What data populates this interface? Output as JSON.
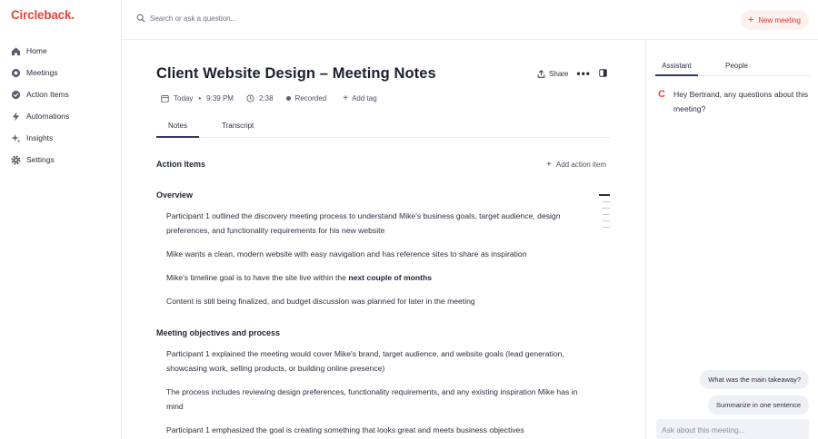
{
  "brand": {
    "logo_text": "Circleback",
    "logo_dot": ".",
    "accent": "#e8443a"
  },
  "sidebar": {
    "items": [
      {
        "label": "Home",
        "icon": "home-icon"
      },
      {
        "label": "Meetings",
        "icon": "meetings-icon"
      },
      {
        "label": "Action Items",
        "icon": "check-circle-icon"
      },
      {
        "label": "Automations",
        "icon": "lightning-icon"
      },
      {
        "label": "Insights",
        "icon": "sparkle-icon"
      },
      {
        "label": "Settings",
        "icon": "gear-icon"
      }
    ]
  },
  "topbar": {
    "search_placeholder": "Search or ask a question...",
    "new_meeting_label": "New meeting"
  },
  "meeting": {
    "title": "Client Website Design – Meeting Notes",
    "share_label": "Share",
    "date": "Today",
    "separator": "•",
    "time": "9:39 PM",
    "duration": "2:38",
    "recorded_label": "Recorded",
    "add_tag_label": "Add tag",
    "tabs": [
      "Notes",
      "Transcript"
    ],
    "action_items_heading": "Action Items",
    "add_action_item_label": "Add action item",
    "overview_heading": "Overview",
    "overview_bullets": [
      "Participant 1 outlined the discovery meeting process to understand Mike's business goals, target audience, design preferences, and functionality requirements for his new website",
      "Mike wants a clean, modern website with easy navigation and has reference sites to share as inspiration",
      "Content is still being finalized, and budget discussion was planned for later in the meeting"
    ],
    "timeline_bullet": {
      "prefix": "Mike's timeline goal is to have the site live within the ",
      "bold": "next couple of months"
    },
    "objectives_heading": "Meeting objectives and process",
    "objectives_bullets": [
      "Participant 1 explained the meeting would cover Mike's brand, target audience, and website goals (lead generation, showcasing work, selling products, or building online presence)",
      "The process includes reviewing design preferences, functionality requirements, and any existing inspiration Mike has in mind",
      "Participant 1 emphasized the goal is creating something that looks great and meets business objectives"
    ]
  },
  "assistant": {
    "tabs": [
      "Assistant",
      "People"
    ],
    "logo_letter": "C",
    "greeting": "Hey Bertrand, any questions about this meeting?",
    "suggestions": [
      "What was the main takeaway?",
      "Summarize in one sentence"
    ],
    "ask_placeholder": "Ask about this meeting..."
  }
}
